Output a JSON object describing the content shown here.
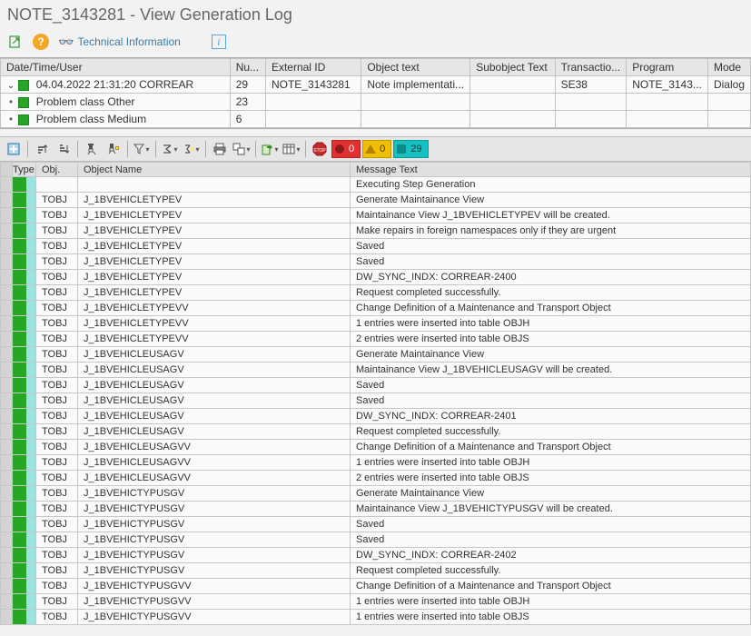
{
  "title": "NOTE_3143281 - View Generation Log",
  "mainToolbar": {
    "technicalInfo": "Technical Information"
  },
  "topGrid": {
    "columns": [
      "Date/Time/User",
      "Nu...",
      "External ID",
      "Object text",
      "Subobject Text",
      "Transactio...",
      "Program",
      "Mode"
    ],
    "row1": {
      "datetime": "04.04.2022  21:31:20  CORREAR",
      "num": "29",
      "externalId": "NOTE_3143281",
      "objectText": "Note implementati...",
      "subobject": "",
      "transaction": "SE38",
      "program": "NOTE_3143...",
      "mode": "Dialog"
    },
    "row2": {
      "label": "Problem class Other",
      "num": "23"
    },
    "row3": {
      "label": "Problem class Medium",
      "num": "6"
    }
  },
  "status": {
    "red": "0",
    "yellow": "0",
    "green": "29"
  },
  "alvColumns": {
    "type": "Type",
    "obj": "Obj.",
    "objName": "Object Name",
    "msg": "Message Text"
  },
  "rows": [
    {
      "obj": "",
      "name": "",
      "msg": "Executing Step Generation"
    },
    {
      "obj": "TOBJ",
      "name": "J_1BVEHICLETYPEV",
      "msg": "Generate Maintainance View"
    },
    {
      "obj": "TOBJ",
      "name": "J_1BVEHICLETYPEV",
      "msg": "Maintainance View J_1BVEHICLETYPEV will be created."
    },
    {
      "obj": "TOBJ",
      "name": "J_1BVEHICLETYPEV",
      "msg": "Make repairs in foreign namespaces only if they are urgent"
    },
    {
      "obj": "TOBJ",
      "name": "J_1BVEHICLETYPEV",
      "msg": "Saved"
    },
    {
      "obj": "TOBJ",
      "name": "J_1BVEHICLETYPEV",
      "msg": "Saved"
    },
    {
      "obj": "TOBJ",
      "name": "J_1BVEHICLETYPEV",
      "msg": "DW_SYNC_INDX: CORREAR-2400"
    },
    {
      "obj": "TOBJ",
      "name": "J_1BVEHICLETYPEV",
      "msg": "Request completed successfully."
    },
    {
      "obj": "TOBJ",
      "name": "J_1BVEHICLETYPEVV",
      "msg": "Change Definition of a Maintenance and Transport Object"
    },
    {
      "obj": "TOBJ",
      "name": "J_1BVEHICLETYPEVV",
      "msg": "1 entries were inserted into table OBJH"
    },
    {
      "obj": "TOBJ",
      "name": "J_1BVEHICLETYPEVV",
      "msg": "2 entries were inserted into table OBJS"
    },
    {
      "obj": "TOBJ",
      "name": "J_1BVEHICLEUSAGV",
      "msg": "Generate Maintainance View"
    },
    {
      "obj": "TOBJ",
      "name": "J_1BVEHICLEUSAGV",
      "msg": "Maintainance View J_1BVEHICLEUSAGV will be created."
    },
    {
      "obj": "TOBJ",
      "name": "J_1BVEHICLEUSAGV",
      "msg": "Saved"
    },
    {
      "obj": "TOBJ",
      "name": "J_1BVEHICLEUSAGV",
      "msg": "Saved"
    },
    {
      "obj": "TOBJ",
      "name": "J_1BVEHICLEUSAGV",
      "msg": "DW_SYNC_INDX: CORREAR-2401"
    },
    {
      "obj": "TOBJ",
      "name": "J_1BVEHICLEUSAGV",
      "msg": "Request completed successfully."
    },
    {
      "obj": "TOBJ",
      "name": "J_1BVEHICLEUSAGVV",
      "msg": "Change Definition of a Maintenance and Transport Object"
    },
    {
      "obj": "TOBJ",
      "name": "J_1BVEHICLEUSAGVV",
      "msg": "1 entries were inserted into table OBJH"
    },
    {
      "obj": "TOBJ",
      "name": "J_1BVEHICLEUSAGVV",
      "msg": "2 entries were inserted into table OBJS"
    },
    {
      "obj": "TOBJ",
      "name": "J_1BVEHICTYPUSGV",
      "msg": "Generate Maintainance View"
    },
    {
      "obj": "TOBJ",
      "name": "J_1BVEHICTYPUSGV",
      "msg": "Maintainance View J_1BVEHICTYPUSGV will be created."
    },
    {
      "obj": "TOBJ",
      "name": "J_1BVEHICTYPUSGV",
      "msg": "Saved"
    },
    {
      "obj": "TOBJ",
      "name": "J_1BVEHICTYPUSGV",
      "msg": "Saved"
    },
    {
      "obj": "TOBJ",
      "name": "J_1BVEHICTYPUSGV",
      "msg": "DW_SYNC_INDX: CORREAR-2402"
    },
    {
      "obj": "TOBJ",
      "name": "J_1BVEHICTYPUSGV",
      "msg": "Request completed successfully."
    },
    {
      "obj": "TOBJ",
      "name": "J_1BVEHICTYPUSGVV",
      "msg": "Change Definition of a Maintenance and Transport Object"
    },
    {
      "obj": "TOBJ",
      "name": "J_1BVEHICTYPUSGVV",
      "msg": "1 entries were inserted into table OBJH"
    },
    {
      "obj": "TOBJ",
      "name": "J_1BVEHICTYPUSGVV",
      "msg": "1 entries were inserted into table OBJS"
    }
  ]
}
